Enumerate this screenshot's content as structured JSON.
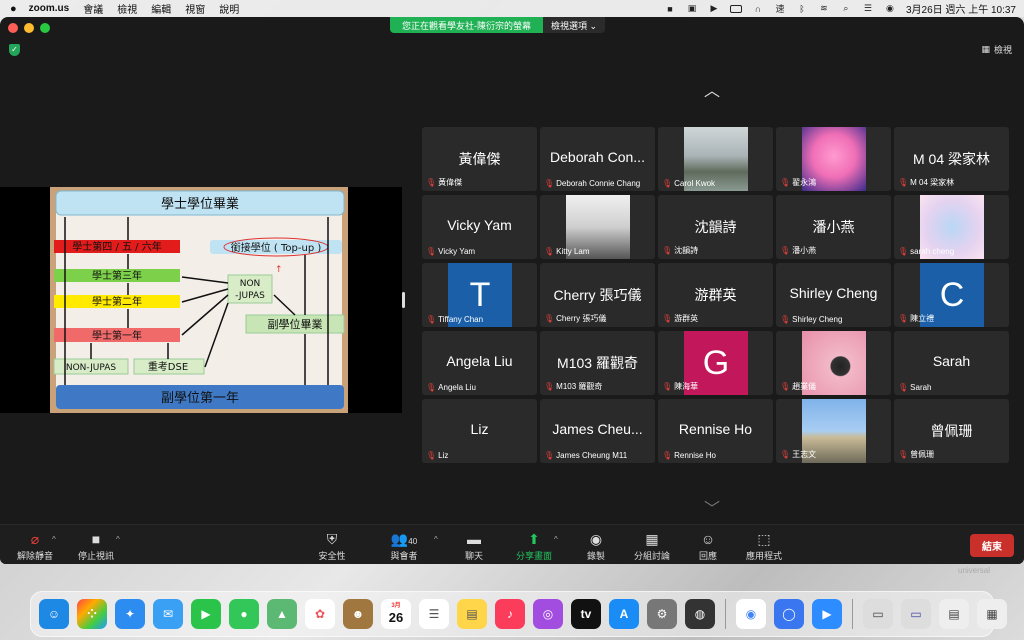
{
  "menubar": {
    "app": "zoom.us",
    "items": [
      "會議",
      "檢視",
      "編輯",
      "視窗",
      "說明"
    ],
    "clock": "3月26日 週六 上午 10:37"
  },
  "banner": {
    "text": "您正在觀看學友社-陳衍宗的螢幕",
    "options": "檢視選項"
  },
  "view_button": "檢視",
  "slide": {
    "top": "學士學位畢業",
    "year46": "學士第四 / 五 / 六年",
    "top_up": "銜接學位 ( Top-up )",
    "year3": "學士第三年",
    "non_jupas_1": "NON",
    "non_jupas_2": "-JUPAS",
    "year2": "學士第二年",
    "assoc_grad": "副學位畢業",
    "year1": "學士第一年",
    "non_jupas_label": "NON-JUPAS",
    "retake": "重考DSE",
    "assoc_year1": "副學位第一年"
  },
  "participants": [
    {
      "big": "黃偉傑",
      "cap": "黃偉傑"
    },
    {
      "big": "Deborah Con...",
      "cap": "Deborah Connie Chang"
    },
    {
      "big": "",
      "cap": "Carol Kwok",
      "pic": "mountain"
    },
    {
      "big": "",
      "cap": "翟永鴻",
      "pic": "pink"
    },
    {
      "big": "M 04 梁家林",
      "cap": "M 04 梁家林"
    },
    {
      "big": "Vicky Yam",
      "cap": "Vicky Yam"
    },
    {
      "big": "",
      "cap": "Kitty Lam",
      "pic": "plane"
    },
    {
      "big": "沈韻詩",
      "cap": "沈韻詩"
    },
    {
      "big": "潘小燕",
      "cap": "潘小燕"
    },
    {
      "big": "",
      "cap": "sarah cheng",
      "pic": "stitch"
    },
    {
      "big": "",
      "cap": "Tiffany Chan",
      "letter": "T",
      "color": "#1a5fa8"
    },
    {
      "big": "Cherry 張巧儀",
      "cap": "Cherry 張巧儀"
    },
    {
      "big": "游群英",
      "cap": "游群英"
    },
    {
      "big": "Shirley Cheng",
      "cap": "Shirley Cheng"
    },
    {
      "big": "",
      "cap": "陳立禮",
      "letter": "C",
      "color": "#1a5fa8"
    },
    {
      "big": "Angela Liu",
      "cap": "Angela Liu"
    },
    {
      "big": "M103 羅觀奇",
      "cap": "M103 羅觀奇"
    },
    {
      "big": "",
      "cap": "陳海華",
      "letter": "G",
      "color": "#c2185b"
    },
    {
      "big": "",
      "cap": "趙業儀",
      "pic": "flowers"
    },
    {
      "big": "Sarah",
      "cap": "Sarah"
    },
    {
      "big": "Liz",
      "cap": "Liz"
    },
    {
      "big": "James Cheu...",
      "cap": "James Cheung M11"
    },
    {
      "big": "Rennise Ho",
      "cap": "Rennise Ho"
    },
    {
      "big": "",
      "cap": "王志文",
      "pic": "city"
    },
    {
      "big": "曾佩珊",
      "cap": "曾佩珊"
    }
  ],
  "toolbar": {
    "unmute": "解除靜音",
    "stop_video": "停止視訊",
    "security": "安全性",
    "participants": "與會者",
    "participants_count": "40",
    "chat": "聊天",
    "share": "分享畫面",
    "record": "錄製",
    "breakout": "分組討論",
    "reactions": "回應",
    "apps": "應用程式",
    "end": "結束"
  },
  "dock": {
    "calendar_month": "3月",
    "calendar_day": "26"
  },
  "watermark": "universal"
}
